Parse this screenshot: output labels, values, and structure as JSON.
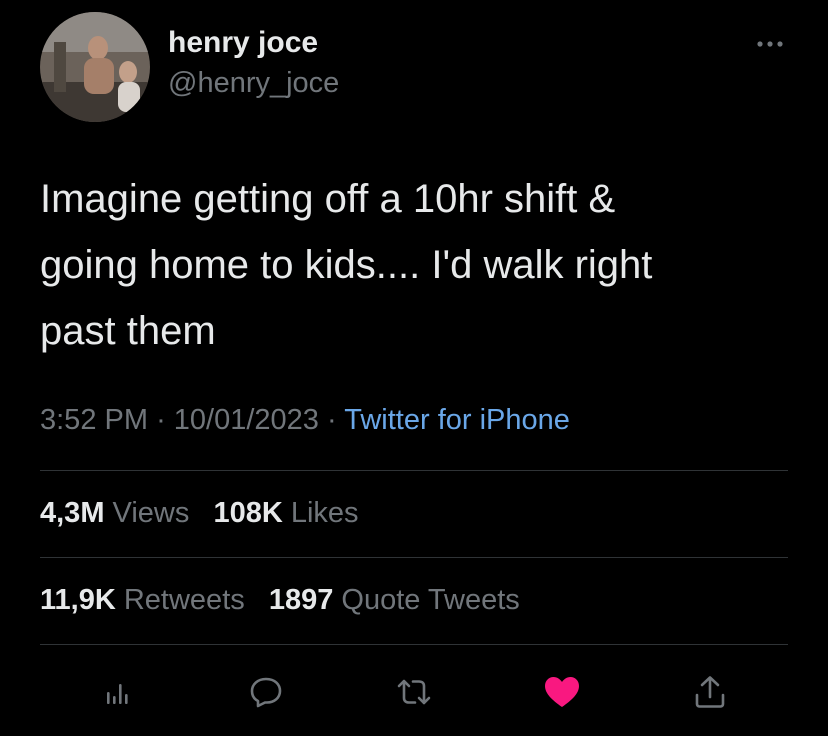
{
  "author": {
    "display_name": "henry joce",
    "handle": "@henry_joce"
  },
  "tweet": {
    "text_lines": [
      "Imagine getting off a 10hr shift &",
      "going home to kids.... I'd walk right",
      "past them"
    ],
    "time": "3:52 PM",
    "date": "10/01/2023",
    "separator": "·",
    "source": "Twitter for iPhone"
  },
  "stats": {
    "views_count": "4,3M",
    "views_label": "Views",
    "likes_count": "108K",
    "likes_label": "Likes",
    "retweets_count": "11,9K",
    "retweets_label": "Retweets",
    "quotes_count": "1897",
    "quotes_label": "Quote Tweets"
  },
  "actions": [
    {
      "icon": "analytics-icon"
    },
    {
      "icon": "reply-icon"
    },
    {
      "icon": "retweet-icon"
    },
    {
      "icon": "heart-icon",
      "active": true
    },
    {
      "icon": "share-icon"
    }
  ],
  "colors": {
    "background": "#000000",
    "text": "#e7e9ea",
    "muted": "#71767b",
    "link": "#6aa7e8",
    "like": "#f91880",
    "divider": "#2f3336"
  }
}
